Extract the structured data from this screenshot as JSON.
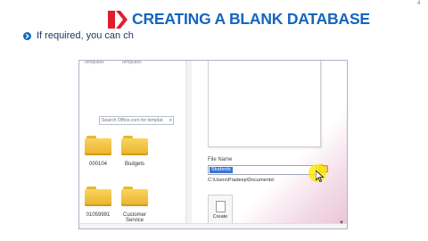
{
  "slide": {
    "corner_mark": "4",
    "title": "CREATING A BLANK DATABASE",
    "bullet_text": "If required, you can ch",
    "colors": {
      "title": "#1565c0",
      "logo": "#e11d2a",
      "bullet": "#1565c0"
    }
  },
  "screenshot": {
    "top_labels": [
      "Templates",
      "Templates"
    ],
    "search": {
      "placeholder": "Search Office.com for templat",
      "icon": "magnifier-icon"
    },
    "template_folders": [
      {
        "label": "000104"
      },
      {
        "label": "Budgets"
      },
      {
        "label": "01059991"
      },
      {
        "label": "Customer Service"
      }
    ],
    "file_name": {
      "label": "File Name",
      "value": "Students",
      "path": "C:\\Users\\Pradeep\\Documents\\"
    },
    "create": {
      "label": "Create"
    }
  }
}
